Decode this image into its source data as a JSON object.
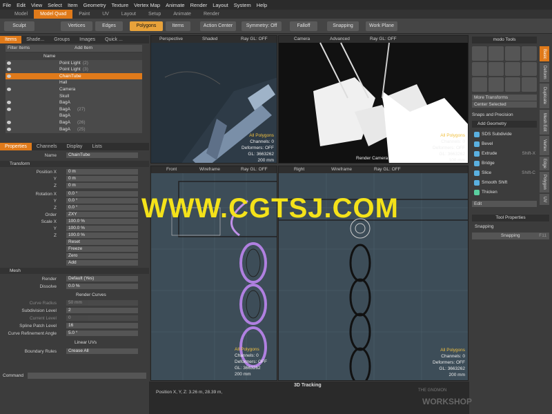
{
  "menu": [
    "File",
    "Edit",
    "View",
    "Select",
    "Item",
    "Geometry",
    "Texture",
    "Vertex Map",
    "Animate",
    "Render",
    "Layout",
    "System",
    "Help"
  ],
  "layouts": [
    "Model",
    "Model Quad",
    "Paint",
    "UV",
    "Layout",
    "Setup",
    "Animate",
    "Render"
  ],
  "toolbar": {
    "sculpt": "Sculpt",
    "vertices": "Vertices",
    "edges": "Edges",
    "polygons": "Polygons",
    "items": "Items",
    "action_center": "Action Center",
    "symmetry": "Symmetry: Off",
    "falloff": "Falloff",
    "snapping": "Snapping",
    "work_plane": "Work Plane"
  },
  "item_tabs": [
    "Items",
    "Shade...",
    "Groups",
    "Images",
    "Quick ..."
  ],
  "filter": {
    "label": "Filter Items",
    "add": "Add Item"
  },
  "name_header": "Name",
  "items": [
    {
      "label": "Point Light",
      "count": "(2)"
    },
    {
      "label": "Point Light",
      "count": "(3)"
    },
    {
      "label": "ChainTube",
      "count": ""
    },
    {
      "label": "Hall",
      "count": ""
    },
    {
      "label": "Camera",
      "count": ""
    },
    {
      "label": "Skull",
      "count": ""
    },
    {
      "label": "BagA",
      "count": ""
    },
    {
      "label": "BagA",
      "count": "(27)"
    },
    {
      "label": "BagA",
      "count": ""
    },
    {
      "label": "BagA",
      "count": "(26)"
    },
    {
      "label": "BagA",
      "count": "(25)"
    }
  ],
  "prop_tabs": [
    "Properties",
    "Channels",
    "Display",
    "Lists"
  ],
  "props": {
    "name_label": "Name",
    "name_value": "ChainTube",
    "transform": "Transform",
    "px_label": "Position X",
    "px": "0 m",
    "py_label": "Y",
    "py": "0 m",
    "pz_label": "Z",
    "pz": "0 m",
    "rx_label": "Rotation X",
    "rx": "0.0 °",
    "ry_label": "Y",
    "ry": "0.0 °",
    "rz_label": "Z",
    "rz": "0.0 °",
    "order_label": "Order",
    "order": "ZXY",
    "sx_label": "Scale X",
    "sx": "100.0 %",
    "sy_label": "Y",
    "sy": "100.0 %",
    "sz_label": "Z",
    "sz": "100.0 %",
    "reset": "Reset",
    "freeze": "Freeze",
    "zero": "Zero",
    "add": "Add",
    "mesh": "Mesh",
    "render_label": "Render",
    "render": "Default (Yes)",
    "dissolve_label": "Dissolve",
    "dissolve": "0.0 %",
    "render_curves": "Render Curves",
    "curve_radius_label": "Curve Radius",
    "curve_radius": "50 mm",
    "subdiv_label": "Subdivision Level",
    "subdiv": "2",
    "current_level_label": "Current Level",
    "current_level": "0",
    "spline_label": "Spline Patch Level",
    "spline": "16",
    "curve_ref_label": "Curve Refinement Angle",
    "curve_ref": "5.0 °",
    "linear_uvs": "Linear UVs",
    "boundary_label": "Boundary Rules",
    "boundary": "Crease All"
  },
  "command_label": "Command",
  "viewports": {
    "vp1": {
      "view": "Perspective",
      "shade": "Shaded",
      "ray": "Ray GL: OFF",
      "info": [
        "All Polygons",
        "Channels: 0",
        "Deformers: OFF",
        "GL: 3663262",
        "200 mm"
      ]
    },
    "vp2": {
      "view": "Camera",
      "shade": "Advanced",
      "ray": "Ray GL: OFF",
      "info": [
        "All Polygons",
        "Channels: 0",
        "Deformers: OFF",
        "GL: 3663262",
        "100 mm"
      ],
      "cam": "Render Camera"
    },
    "vp3": {
      "view": "Front",
      "shade": "Wireframe",
      "ray": "Ray GL: OFF",
      "info": [
        "All Polygons",
        "Channels: 0",
        "Deformers: OFF",
        "GL: 3663262",
        "200 mm"
      ]
    },
    "vp4": {
      "view": "Right",
      "shade": "Wireframe",
      "ray": "Ray GL: OFF",
      "info": [
        "All Polygons",
        "Channels: 0",
        "Deformers: OFF",
        "GL: 3663262",
        "200 mm"
      ]
    }
  },
  "right": {
    "title": "modo Tools",
    "more_transforms": "More Transforms",
    "center_selected": "Center Selected",
    "snaps": "Snaps and Precision",
    "add_geometry": "Add Geometry",
    "tools": [
      "SDS Subdivide",
      "Bevel",
      "Extrude",
      "Bridge",
      "Slice",
      "Smooth Shift",
      "Thicken"
    ],
    "shortcuts": [
      "",
      "",
      "Shift-X",
      "",
      "Shift-C",
      "",
      ""
    ],
    "edit": "Edit",
    "tool_properties": "Tool Properties",
    "snapping": "Snapping",
    "snapping2": "Snapping",
    "f11": "F11",
    "tabs": [
      "Basic",
      "Deform",
      "Duplicate",
      "Mesh Edit",
      "Vertex",
      "Edge",
      "Polygon",
      "UV"
    ]
  },
  "status": {
    "title": "3D Tracking",
    "position": "Position X, Y, Z:   3.26 m,  28.39 m,"
  },
  "watermark": "WWW.CGTSJ.COM",
  "logo": {
    "line1": "THE GNOMON",
    "line2": "WORKSHOP"
  }
}
